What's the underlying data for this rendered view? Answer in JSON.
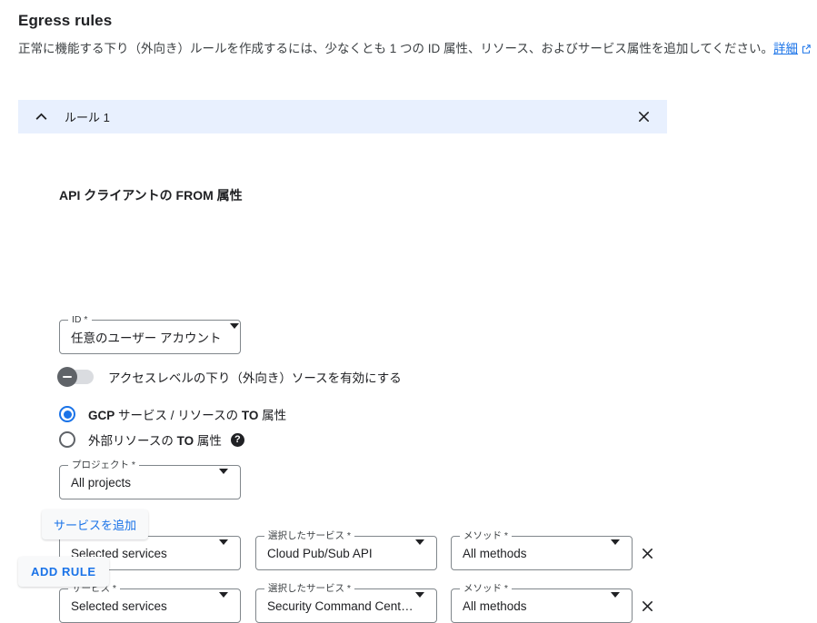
{
  "header": {
    "title": "Egress rules",
    "description": "正常に機能する下り（外向き）ルールを作成するには、少なくとも 1 つの ID 属性、リソース、およびサービス属性を追加してください。",
    "learn_more_label": "詳細",
    "external_link_icon": "external-link-icon"
  },
  "rule": {
    "collapse_icon": "chevron-up-icon",
    "title": "ルール 1",
    "close_icon": "close-icon",
    "section_heading": "API クライアントの FROM 属性",
    "id_field": {
      "legend": "ID *",
      "value": "任意のユーザー アカウント",
      "caret_icon": "chevron-down-icon"
    },
    "access_level_toggle": {
      "label": "アクセスレベルの下り（外向き）ソースを有効にする",
      "state": "off"
    },
    "to_attributes": {
      "options": [
        {
          "label_html": "<b>GCP</b> サービス / リソースの <b>TO</b> 属性",
          "selected": true,
          "help": false
        },
        {
          "label_html": "外部リソースの <b>TO</b> 属性",
          "selected": false,
          "help": true
        }
      ],
      "help_icon": "help-circle-icon"
    },
    "project_field": {
      "legend": "プロジェクト *",
      "value": "All projects",
      "caret_icon": "chevron-down-icon"
    },
    "service_rows_labels": {
      "service": "サービス *",
      "selected_service": "選択したサービス *",
      "method": "メソッド *",
      "remove_icon": "close-icon"
    },
    "service_rows": [
      {
        "service": "Selected services",
        "selected_service": "Cloud Pub/Sub API",
        "method": "All methods"
      },
      {
        "service": "Selected services",
        "selected_service": "Security Command Center…",
        "method": "All methods"
      }
    ],
    "add_service_label": "サービスを追加"
  },
  "add_rule_label": "ADD RULE",
  "colors": {
    "accent": "#1a73e8",
    "rule_header_bg": "#e8f0fe",
    "field_border": "#80868b",
    "button_bg": "#f8f9fa",
    "text": "#202124"
  }
}
